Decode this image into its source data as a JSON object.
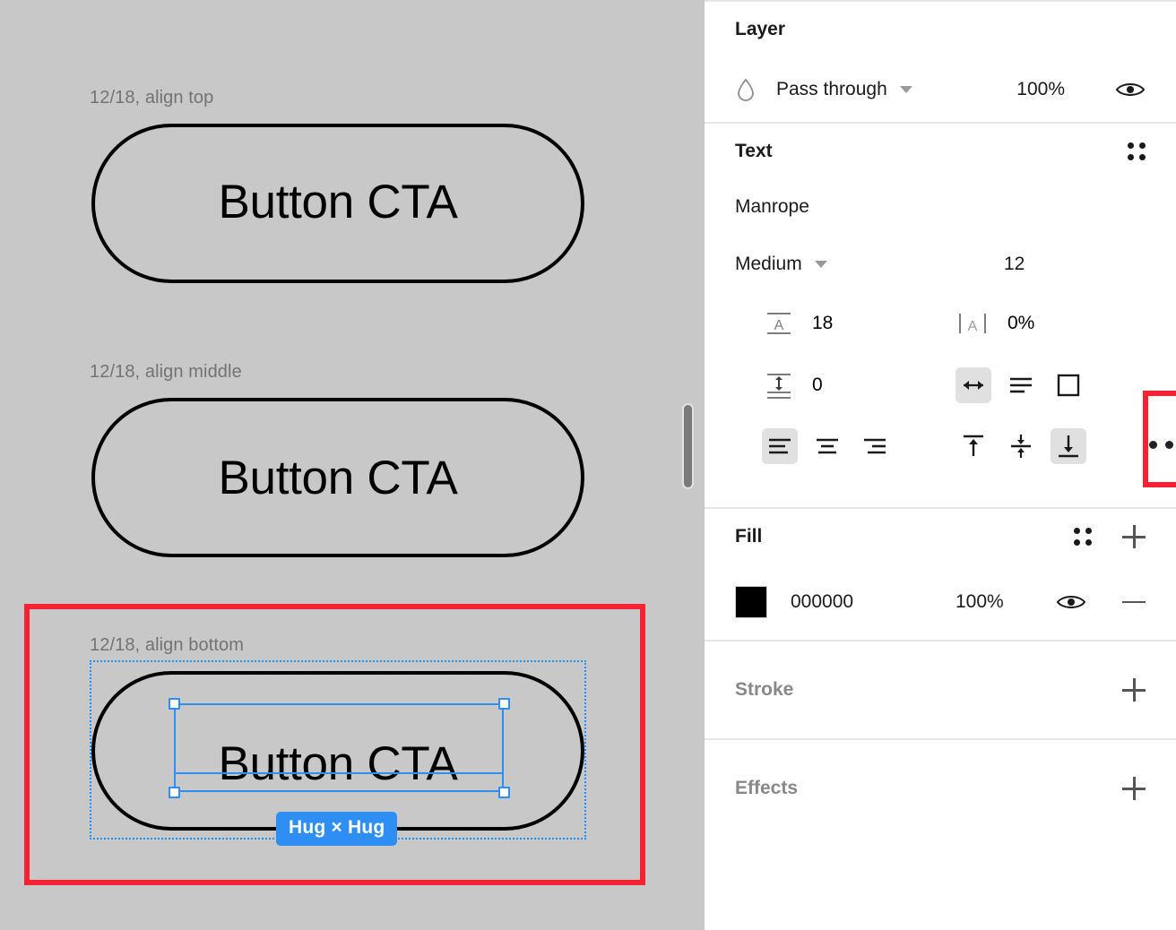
{
  "canvas": {
    "background_color": "#c8c8c8",
    "highlight_color": "#f42233",
    "selection_color": "#2f8ef4",
    "groups": [
      {
        "label": "12/18, align top",
        "button_label": "Button CTA"
      },
      {
        "label": "12/18, align middle",
        "button_label": "Button CTA"
      },
      {
        "label": "12/18, align bottom",
        "button_label": "Button CTA"
      }
    ],
    "selection_badge": "Hug × Hug"
  },
  "panel": {
    "layer": {
      "title": "Layer",
      "blend_mode": "Pass through",
      "opacity": "100%",
      "visibility_icon": "eye-icon",
      "blend_icon": "blend-drop-icon",
      "chevron_icon": "chevron-down-icon"
    },
    "text": {
      "title": "Text",
      "settings_icon": "text-settings-icon",
      "font_family": "Manrope",
      "font_weight": "Medium",
      "font_size": "12",
      "line_height": "18",
      "letter_spacing": "0%",
      "paragraph_spacing": "0",
      "line_height_icon": "line-height-icon",
      "letter_spacing_icon": "letter-spacing-icon",
      "paragraph_spacing_icon": "paragraph-spacing-icon",
      "resize_options": [
        {
          "name": "auto-width-icon",
          "active": true
        },
        {
          "name": "auto-height-icon",
          "active": false
        },
        {
          "name": "fixed-size-icon",
          "active": false
        }
      ],
      "horizontal_align": [
        {
          "name": "align-left-icon",
          "active": true
        },
        {
          "name": "align-center-icon",
          "active": false
        },
        {
          "name": "align-right-icon",
          "active": false
        }
      ],
      "vertical_align": [
        {
          "name": "align-top-icon",
          "active": false
        },
        {
          "name": "align-middle-icon",
          "active": false
        },
        {
          "name": "align-bottom-icon",
          "active": true
        }
      ],
      "more_options_icon": "more-options-icon"
    },
    "fill": {
      "title": "Fill",
      "settings_icon": "fill-settings-icon",
      "add_icon": "add-icon",
      "color_hex": "000000",
      "opacity": "100%",
      "visibility_icon": "eye-icon",
      "remove_icon": "remove-icon"
    },
    "stroke": {
      "title": "Stroke",
      "add_icon": "add-icon"
    },
    "effects": {
      "title": "Effects",
      "add_icon": "add-icon"
    }
  }
}
